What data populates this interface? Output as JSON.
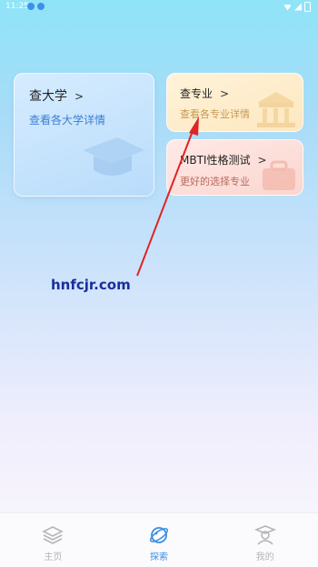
{
  "status_bar": {
    "time": "11:25"
  },
  "cards": {
    "university": {
      "title": "查大学",
      "chevron": ">",
      "subtitle": "查看各大学详情"
    },
    "major": {
      "title": "查专业",
      "chevron": ">",
      "subtitle": "查看各专业详情"
    },
    "mbti": {
      "title": "MBTI性格测试",
      "chevron": ">",
      "subtitle": "更好的选择专业"
    }
  },
  "watermark": "hnfcjr.com",
  "tabbar": {
    "items": [
      {
        "label": "主页",
        "icon": "layers-icon",
        "active": false
      },
      {
        "label": "探索",
        "icon": "planet-icon",
        "active": true
      },
      {
        "label": "我的",
        "icon": "graduate-icon",
        "active": false
      }
    ]
  },
  "colors": {
    "active_tab": "#3a8fe0",
    "inactive_tab": "#b5b5b5",
    "annotation_arrow": "#e02424",
    "watermark": "#1b2d9c"
  }
}
